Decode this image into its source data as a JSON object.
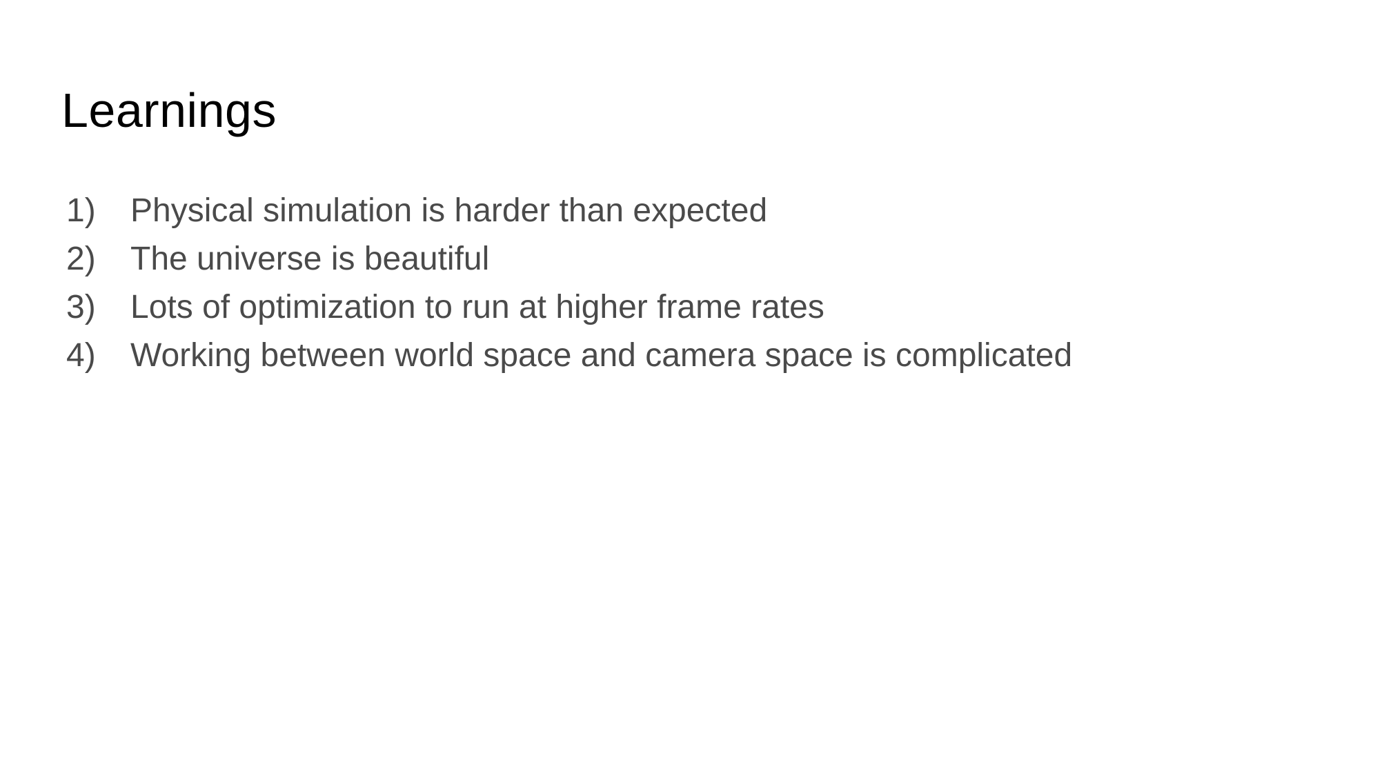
{
  "slide": {
    "title": "Learnings",
    "items": [
      {
        "number": "1)",
        "text": "Physical simulation is harder than expected"
      },
      {
        "number": "2)",
        "text": "The universe is beautiful"
      },
      {
        "number": "3)",
        "text": "Lots of optimization to run at higher frame rates"
      },
      {
        "number": "4)",
        "text": "Working between world space and camera space is complicated"
      }
    ]
  },
  "colors": {
    "background": "#ffffff",
    "title": "#000000",
    "body_text": "#4a4a4a"
  }
}
